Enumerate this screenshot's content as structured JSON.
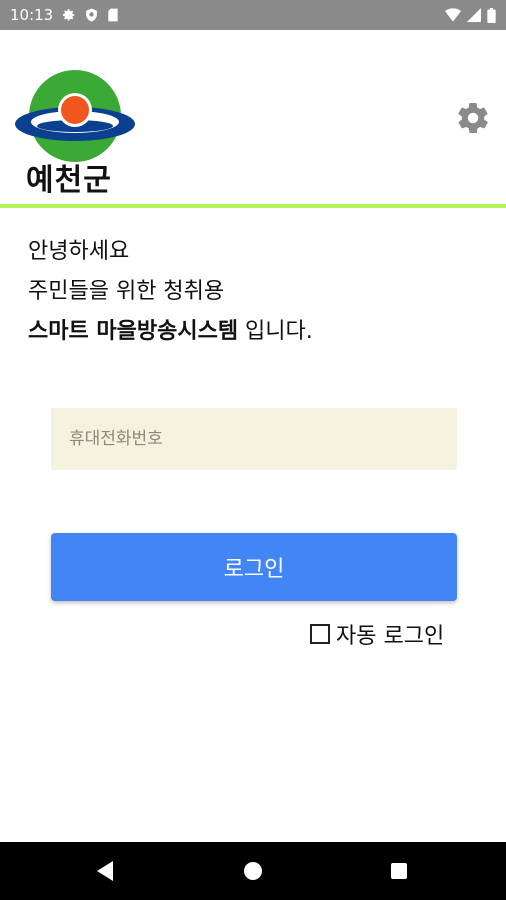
{
  "status_bar": {
    "time": "10:13",
    "left_icons": [
      "settings-icon",
      "shield-icon",
      "sim-card-icon"
    ],
    "right_icons": [
      "wifi-icon",
      "signal-icon",
      "battery-icon"
    ]
  },
  "header": {
    "logo_text": "예천군",
    "settings_icon": "gear-icon",
    "divider_color": "#b6f25a"
  },
  "greeting": {
    "line1": "안녕하세요",
    "line2": "주민들을 위한 청취용",
    "line3_bold": "스마트 마을방송시스템",
    "line3_rest": " 입니다."
  },
  "login_form": {
    "phone_placeholder": "휴대전화번호",
    "phone_value": "",
    "login_button_label": "로그인",
    "auto_login_label": "자동 로그인",
    "auto_login_checked": false,
    "button_color": "#4285f4",
    "input_bg_color": "#f4f2df"
  },
  "nav_bar": {
    "buttons": [
      "back-icon",
      "home-icon",
      "recents-icon"
    ]
  }
}
